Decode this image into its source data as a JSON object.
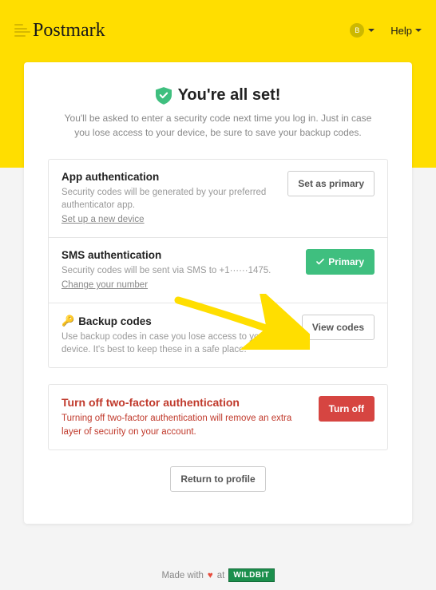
{
  "brand": "Postmark",
  "header": {
    "avatar_initial": "B",
    "help_label": "Help"
  },
  "hero": {
    "title": "You're all set!",
    "subtitle": "You'll be asked to enter a security code next time you log in. Just in case you lose access to your device, be sure to save your backup codes."
  },
  "methods": {
    "app": {
      "title": "App authentication",
      "desc": "Security codes will be generated by your preferred authenticator app.",
      "link": "Set up a new device",
      "button": "Set as primary"
    },
    "sms": {
      "title": "SMS authentication",
      "desc": "Security codes will be sent via SMS to +1······1475.",
      "link": "Change your number",
      "badge": "Primary"
    },
    "backup": {
      "title": "Backup codes",
      "desc": "Use backup codes in case you lose access to your device. It's best to keep these in a safe place.",
      "button": "View codes"
    }
  },
  "danger": {
    "title": "Turn off two-factor authentication",
    "desc": "Turning off two-factor authentication will remove an extra layer of security on your account.",
    "button": "Turn off"
  },
  "return_button": "Return to profile",
  "footer": {
    "prefix": "Made with",
    "middle": "at",
    "brand": "WILDBIT"
  }
}
